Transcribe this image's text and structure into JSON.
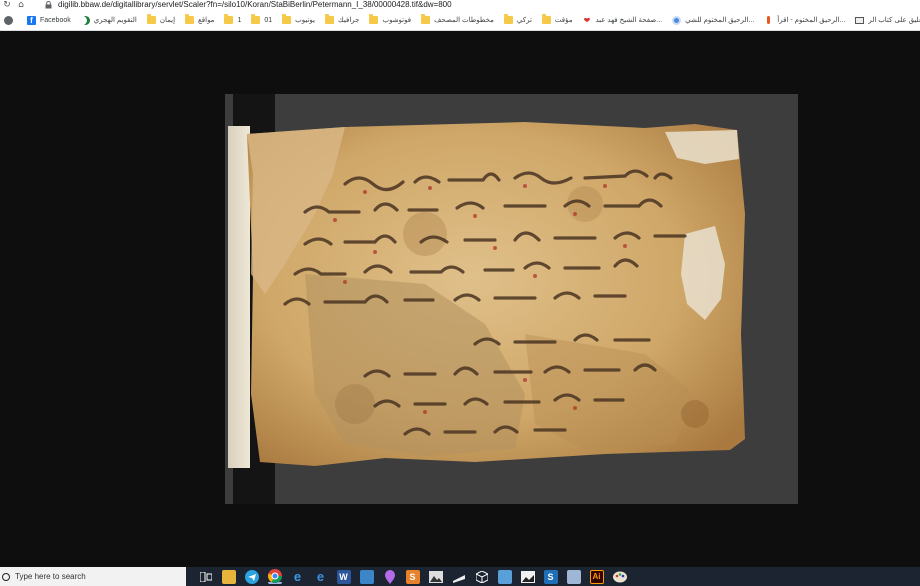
{
  "browser": {
    "url": "digilib.bbaw.de/digitallibrary/servlet/Scaler?fn=/silo10/Koran/StaBiBerlin/Petermann_I_38/00000428.tif&dw=800"
  },
  "bookmarks": [
    {
      "label": "",
      "icon": "globe-icon"
    },
    {
      "label": "Facebook",
      "icon": "facebook-icon"
    },
    {
      "label": "التقويم الهجري",
      "icon": "crescent-icon"
    },
    {
      "label": "إيمان",
      "icon": "folder-icon"
    },
    {
      "label": "مواقع",
      "icon": "folder-icon"
    },
    {
      "label": "1",
      "icon": "folder-icon"
    },
    {
      "label": "01",
      "icon": "folder-icon"
    },
    {
      "label": "يوتيوب",
      "icon": "folder-icon"
    },
    {
      "label": "جرافيك",
      "icon": "folder-icon"
    },
    {
      "label": "فوتوشوب",
      "icon": "folder-icon"
    },
    {
      "label": "مخطوطات المصحف",
      "icon": "folder-icon"
    },
    {
      "label": "تركي",
      "icon": "folder-icon"
    },
    {
      "label": "مؤقت",
      "icon": "folder-icon"
    },
    {
      "label": "صفحة الشيخ فهد عبد...",
      "icon": "heart-icon"
    },
    {
      "label": "الرحيق المختوم للشي...",
      "icon": "site-icon"
    },
    {
      "label": "الرحيق المختوم - اقرأ...",
      "icon": "pin-icon"
    },
    {
      "label": "التعليق على كتاب الر...",
      "icon": "book-icon"
    }
  ],
  "taskbar": {
    "search_placeholder": "Type here to search",
    "ai_label": "Ai"
  },
  "colors": {
    "background": "#0e0e0e",
    "taskbar": "#1c2431",
    "parchment": "#d9b47a"
  }
}
